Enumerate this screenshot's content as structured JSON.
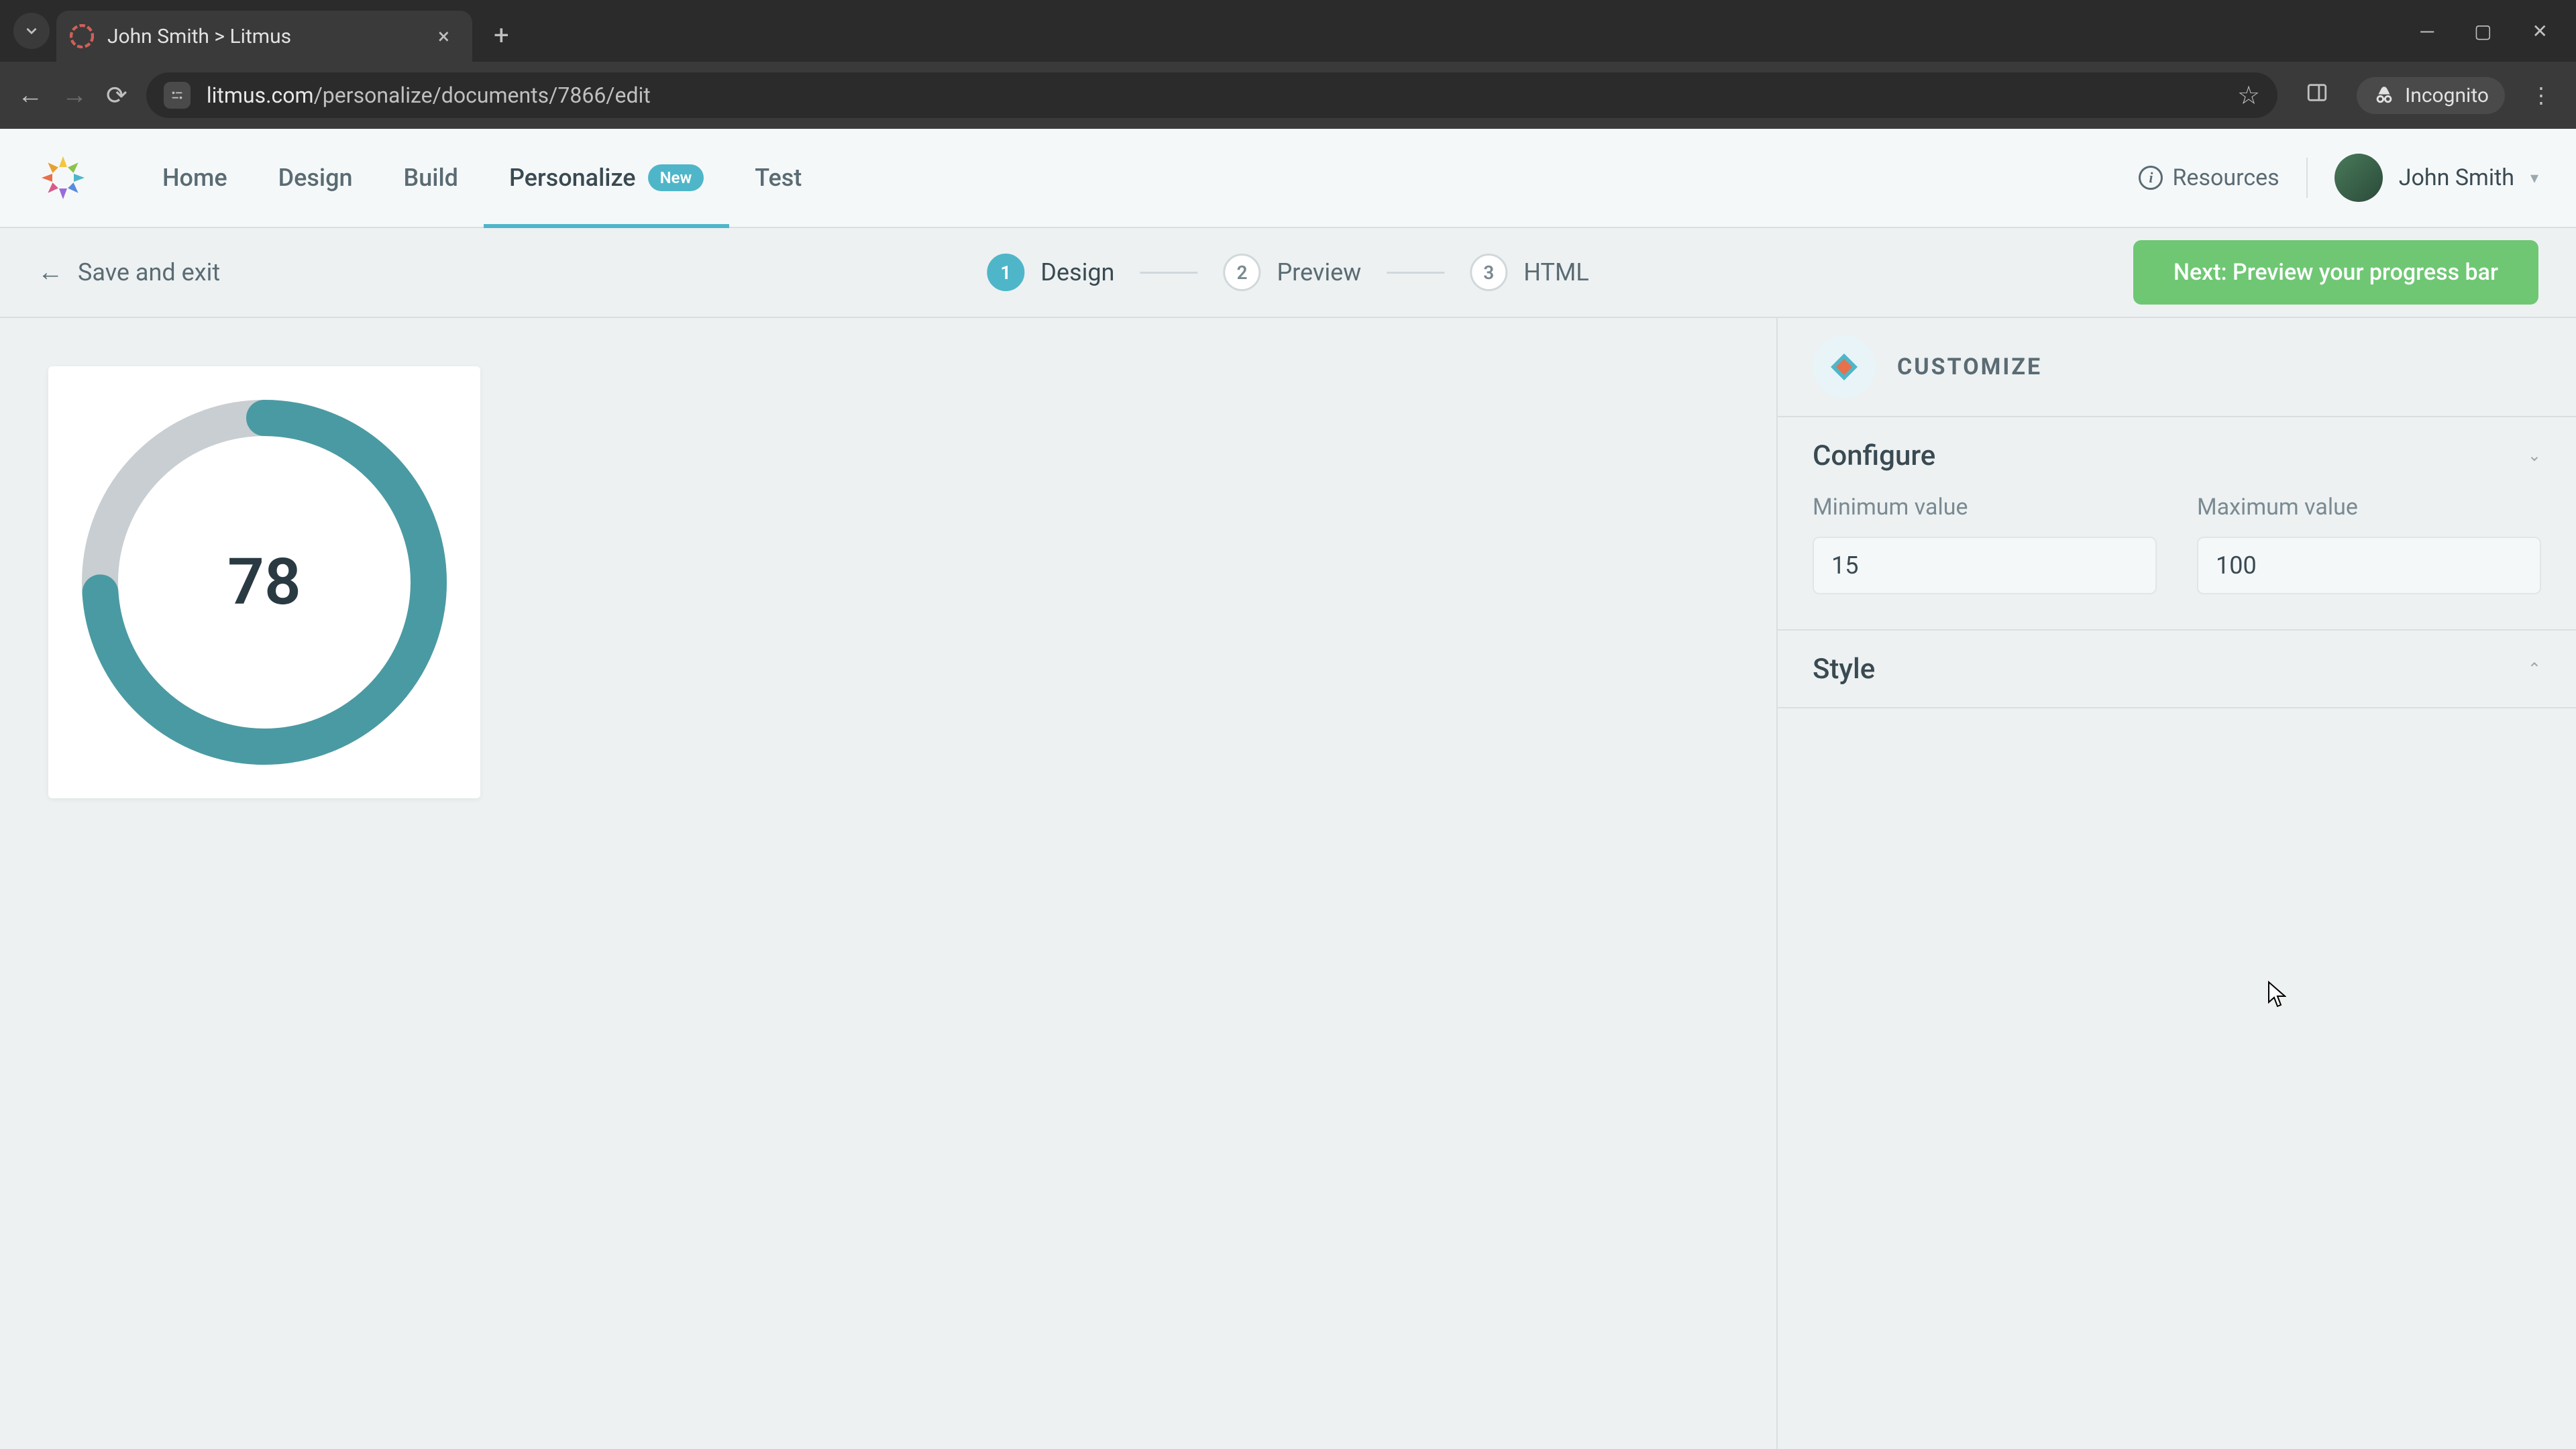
{
  "browser": {
    "tab_title": "John Smith > Litmus",
    "url_domain": "litmus.com",
    "url_path": "/personalize/documents/7866/edit",
    "incognito_label": "Incognito"
  },
  "nav": {
    "items": [
      {
        "label": "Home"
      },
      {
        "label": "Design"
      },
      {
        "label": "Build"
      },
      {
        "label": "Personalize",
        "badge": "New"
      },
      {
        "label": "Test"
      }
    ],
    "resources_label": "Resources",
    "user_name": "John Smith"
  },
  "toolbar": {
    "save_exit_label": "Save and exit",
    "steps": [
      {
        "num": "1",
        "label": "Design"
      },
      {
        "num": "2",
        "label": "Preview"
      },
      {
        "num": "3",
        "label": "HTML"
      }
    ],
    "next_label": "Next: Preview your progress bar"
  },
  "panel": {
    "title": "CUSTOMIZE",
    "sections": {
      "configure": {
        "title": "Configure",
        "min_label": "Minimum value",
        "min_value": "15",
        "max_label": "Maximum value",
        "max_value": "100"
      },
      "style": {
        "title": "Style"
      }
    }
  },
  "chart_data": {
    "type": "pie",
    "title": "",
    "value": 78,
    "min": 15,
    "max": 100,
    "display_value": "78",
    "ring_color": "#4a9aa3",
    "track_color": "#c8ced1"
  }
}
